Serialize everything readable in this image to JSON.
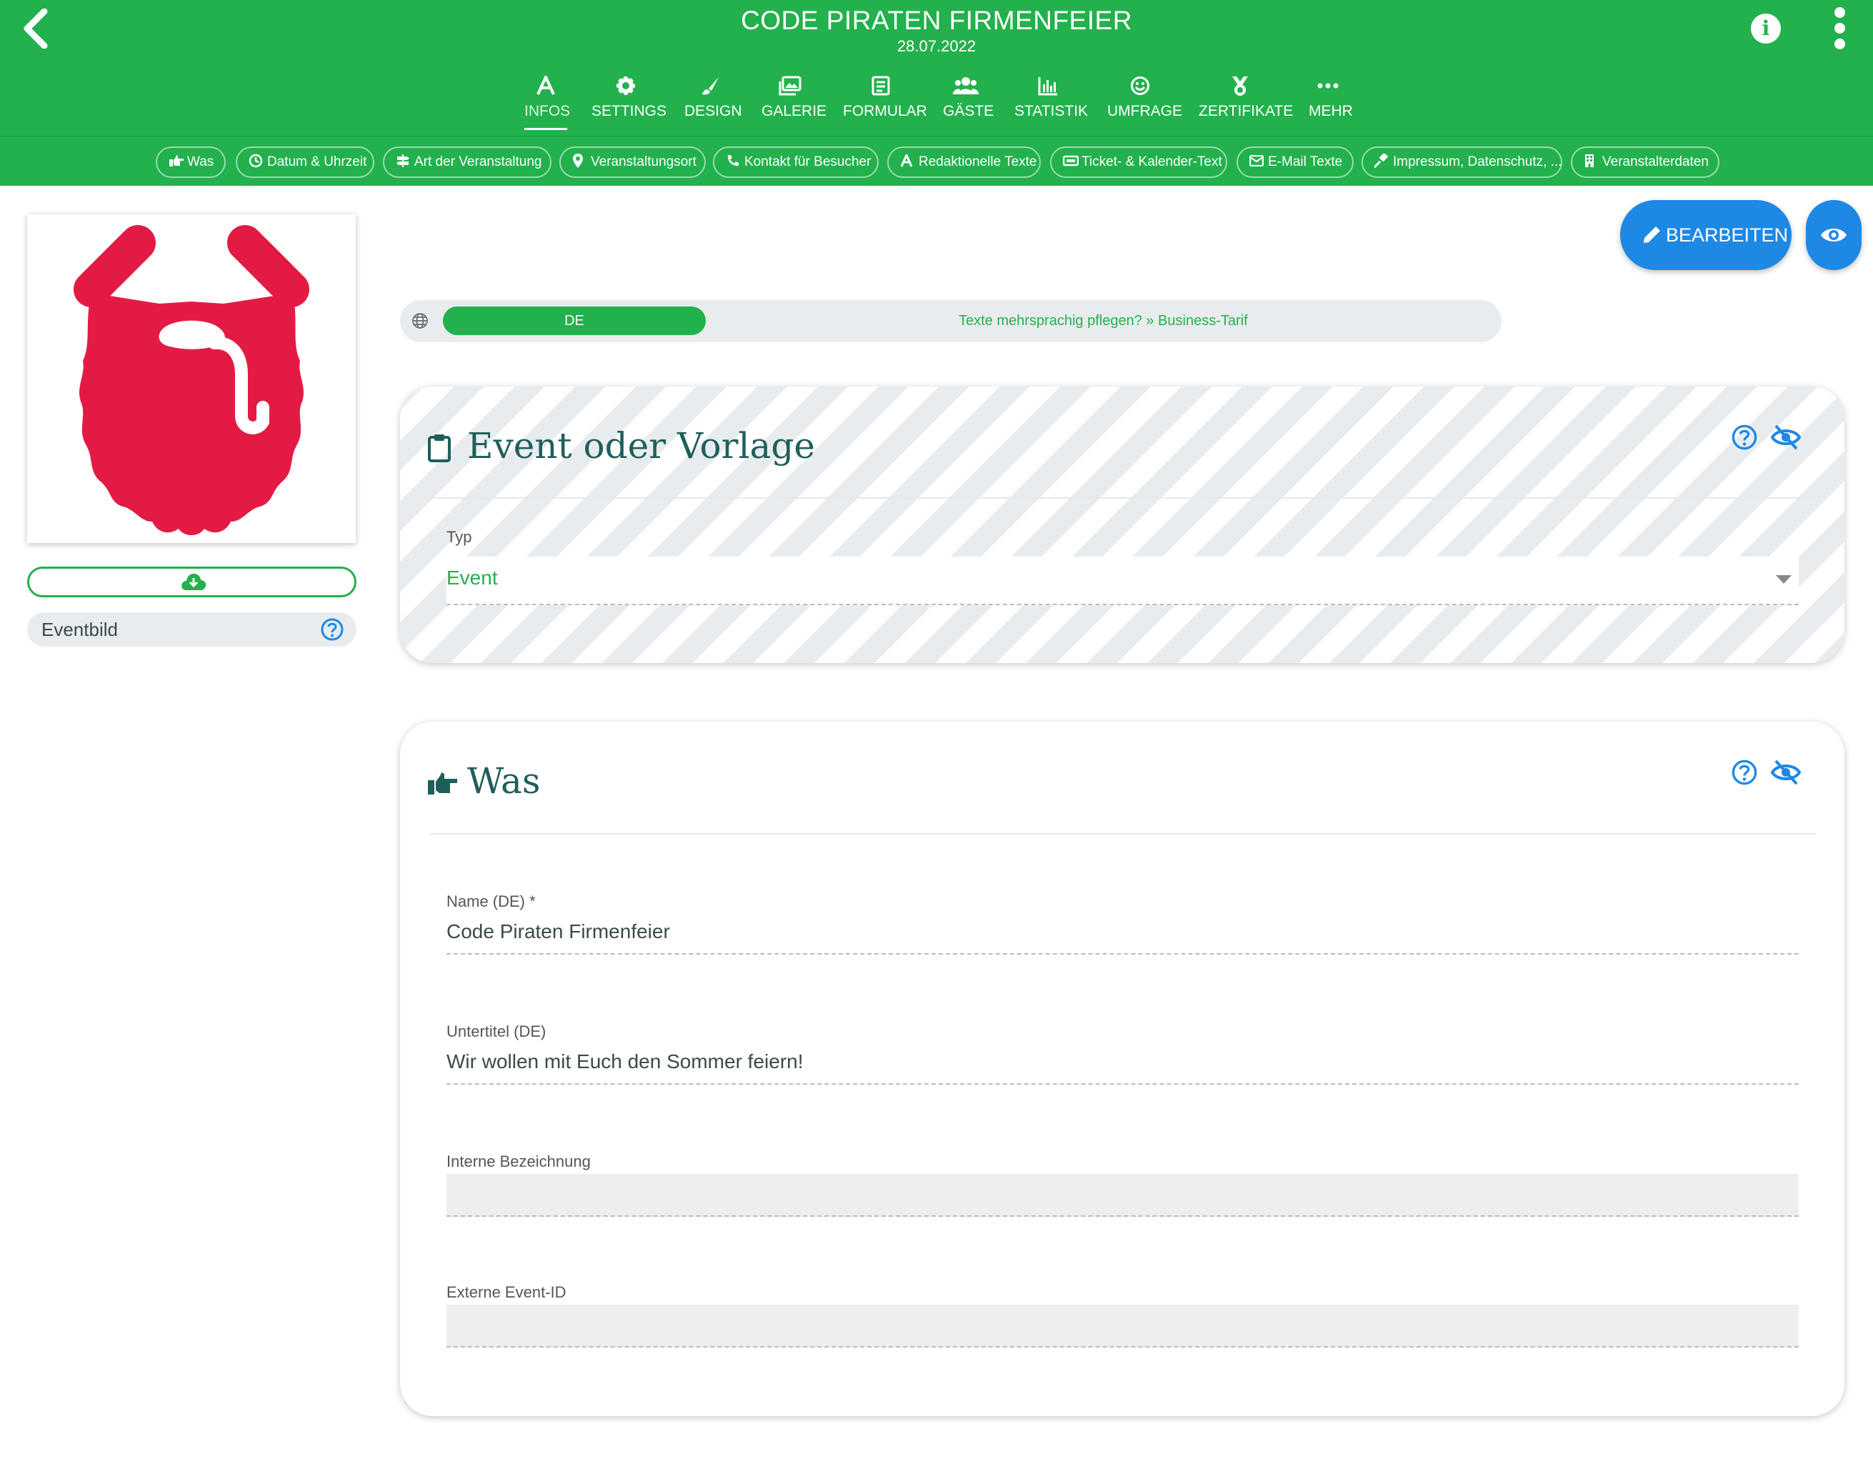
{
  "header": {
    "title": "CODE PIRATEN FIRMENFEIER",
    "date": "28.07.2022",
    "back_icon": "chevron-left-icon",
    "info_icon": "info-icon",
    "more_icon": "more-vertical-icon",
    "brand_color": "#22b14c"
  },
  "tabs": [
    {
      "label": "INFOS",
      "icon": "text-a-icon",
      "active": true
    },
    {
      "label": "SETTINGS",
      "icon": "gear-icon"
    },
    {
      "label": "DESIGN",
      "icon": "paintbrush-icon"
    },
    {
      "label": "GALERIE",
      "icon": "images-icon"
    },
    {
      "label": "FORMULAR",
      "icon": "form-icon"
    },
    {
      "label": "GÄSTE",
      "icon": "users-icon"
    },
    {
      "label": "STATISTIK",
      "icon": "bar-chart-icon"
    },
    {
      "label": "UMFRAGE",
      "icon": "smiley-icon"
    },
    {
      "label": "ZERTIFIKATE",
      "icon": "medal-icon"
    },
    {
      "label": "MEHR",
      "icon": "ellipsis-icon"
    }
  ],
  "subnav": [
    {
      "label": "Was",
      "icon": "hand-pointing-icon"
    },
    {
      "label": "Datum & Uhrzeit",
      "icon": "clock-icon"
    },
    {
      "label": "Art der Veranstaltung",
      "icon": "signpost-icon"
    },
    {
      "label": "Veranstaltungsort",
      "icon": "map-pin-icon"
    },
    {
      "label": "Kontakt für Besucher",
      "icon": "phone-icon"
    },
    {
      "label": "Redaktionelle Texte",
      "icon": "text-a-icon"
    },
    {
      "label": "Ticket- & Kalender-Text",
      "icon": "ticket-icon"
    },
    {
      "label": "E-Mail Texte",
      "icon": "envelope-icon"
    },
    {
      "label": "Impressum, Datenschutz, ...",
      "icon": "gavel-icon"
    },
    {
      "label": "Veranstalterdaten",
      "icon": "building-icon"
    }
  ],
  "sidebar": {
    "image_icon": "pirate-beard-logo",
    "upload_icon": "cloud-download-icon",
    "eventbild_label": "Eventbild"
  },
  "actions": {
    "edit_label": "BEARBEITEN",
    "preview_icon": "eye-icon",
    "accent_color": "#1e88e5"
  },
  "language": {
    "current": "DE",
    "note": "Texte mehrsprachig pflegen? » Business-Tarif"
  },
  "card_event": {
    "title": "Event oder Vorlage",
    "icon": "clipboard-icon",
    "type_label": "Typ",
    "type_value": "Event"
  },
  "card_was": {
    "title": "Was",
    "icon": "hand-pointing-icon",
    "name_label": "Name (DE) *",
    "name_value": "Code Piraten Firmenfeier",
    "subtitle_label": "Untertitel (DE)",
    "subtitle_value": "Wir wollen mit Euch den Sommer feiern!",
    "internal_label": "Interne Bezeichnung",
    "internal_value": "",
    "external_label": "Externe Event-ID",
    "external_value": ""
  }
}
